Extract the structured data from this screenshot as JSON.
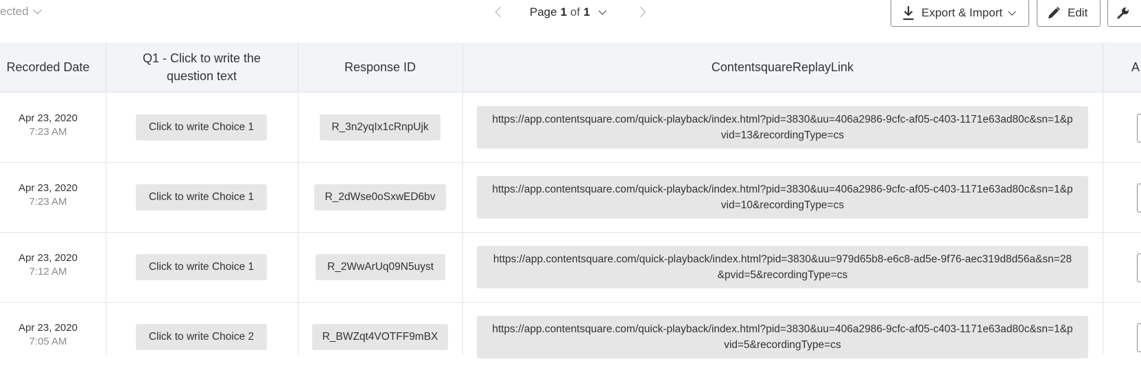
{
  "toolbar": {
    "selected_label": "ected",
    "page_prefix": "Page",
    "page_current": "1",
    "page_of": "of",
    "page_total": "1",
    "export_label": "Export & Import",
    "edit_label": "Edit",
    "icons": [
      "chevron-down-icon",
      "chevron-left-icon",
      "chevron-right-icon",
      "download-icon",
      "pencil-icon",
      "wrench-icon"
    ]
  },
  "table": {
    "columns": [
      "Recorded Date",
      "Q1 - Click to write the question text",
      "Response ID",
      "ContentsquareReplayLink",
      "A"
    ],
    "rows": [
      {
        "date": "Apr 23, 2020",
        "time": "7:23 AM",
        "choice": "Click to write Choice 1",
        "response_id": "R_3n2yqIx1cRnpUjk",
        "link": "https://app.contentsquare.com/quick-playback/index.html?pid=3830&uu=406a2986-9cfc-af05-c403-1171e63ad80c&sn=1&pvid=13&recordingType=cs"
      },
      {
        "date": "Apr 23, 2020",
        "time": "7:23 AM",
        "choice": "Click to write Choice 1",
        "response_id": "R_2dWse0oSxwED6bv",
        "link": "https://app.contentsquare.com/quick-playback/index.html?pid=3830&uu=406a2986-9cfc-af05-c403-1171e63ad80c&sn=1&pvid=10&recordingType=cs"
      },
      {
        "date": "Apr 23, 2020",
        "time": "7:12 AM",
        "choice": "Click to write Choice 1",
        "response_id": "R_2WwArUq09N5uyst",
        "link": "https://app.contentsquare.com/quick-playback/index.html?pid=3830&uu=979d65b8-e6c8-ad5e-9f76-aec319d8d56a&sn=28&pvid=5&recordingType=cs"
      },
      {
        "date": "Apr 23, 2020",
        "time": "7:05 AM",
        "choice": "Click to write Choice 2",
        "response_id": "R_BWZqt4VOTFF9mBX",
        "link": "https://app.contentsquare.com/quick-playback/index.html?pid=3830&uu=406a2986-9cfc-af05-c403-1171e63ad80c&sn=1&pvid=5&recordingType=cs"
      }
    ]
  },
  "colors": {
    "header_bg": "#f2f4f7",
    "chip_bg": "#e6e6e6",
    "muted_text": "#8a8a8a"
  }
}
